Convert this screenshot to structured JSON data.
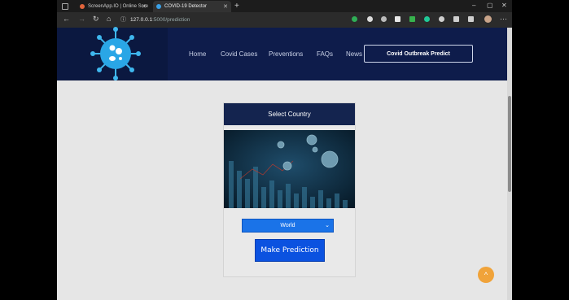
{
  "browser": {
    "tabs": [
      {
        "label": "ScreenApp.IO | Online Scre"
      },
      {
        "label": "COVID-19 Detector"
      }
    ],
    "new_tab": "+",
    "window_controls": {
      "minimize": "–",
      "maximize": "▢",
      "close": "✕"
    },
    "url_host": "127.0.0.1",
    "url_path": ":5000/prediction",
    "icons": [
      "back-icon",
      "forward-icon",
      "reload-icon",
      "home-icon",
      "info-icon"
    ]
  },
  "header": {
    "nav": [
      "Home",
      "Covid Cases",
      "Preventions",
      "FAQs",
      "News"
    ],
    "cta": "Covid Outbreak Predict"
  },
  "card": {
    "title": "Select Country",
    "selected_country": "World",
    "predict_label": "Make Prediction"
  },
  "back_to_top": "^",
  "colors": {
    "header_bg": "#0e1c4b",
    "card_title_bg": "#14244f",
    "select_bg": "#1a73e8",
    "predict_bg": "#0b52e0",
    "back_to_top_bg": "#f0a33a",
    "page_bg": "#e6e6e6"
  }
}
